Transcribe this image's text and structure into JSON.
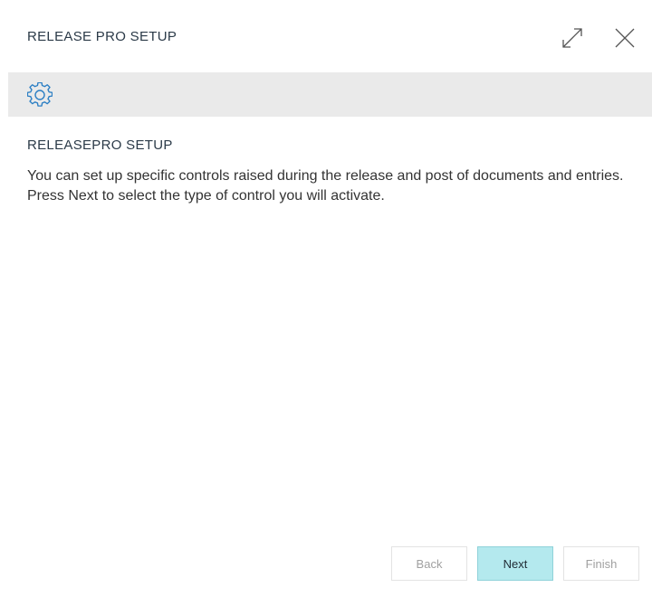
{
  "dialog": {
    "title": "RELEASE PRO SETUP",
    "expand_icon": "expand-icon",
    "close_icon": "close-icon"
  },
  "banner": {
    "icon": "gear-icon",
    "icon_color": "#2c7fc4",
    "background": "#eaeaea"
  },
  "content": {
    "heading": "RELEASEPRO SETUP",
    "text": "You can set up specific controls raised during the release and post of documents and entries. Press Next to select the type of control you will activate."
  },
  "footer": {
    "back_label": "Back",
    "next_label": "Next",
    "finish_label": "Finish",
    "next_color": "#b4e9ee"
  }
}
